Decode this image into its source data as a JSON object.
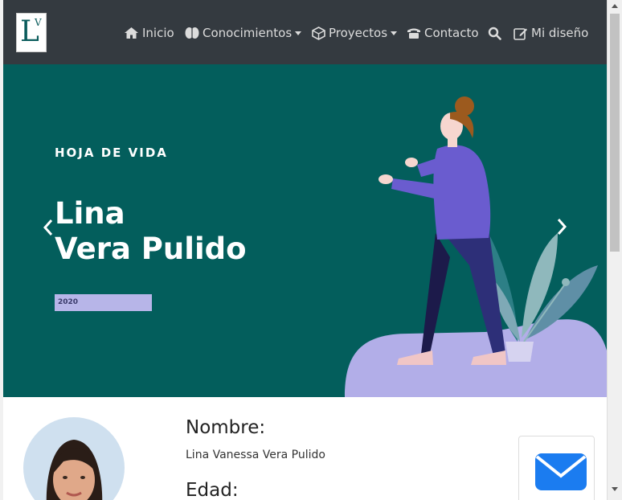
{
  "nav": {
    "items": [
      {
        "label": "Inicio",
        "icon": "home-icon"
      },
      {
        "label": "Conocimientos",
        "icon": "brain-icon",
        "dropdown": true
      },
      {
        "label": "Proyectos",
        "icon": "cube-icon",
        "dropdown": true
      },
      {
        "label": "Contacto",
        "icon": "phone-icon"
      },
      {
        "label": "Mi diseño",
        "icon": "edit-icon"
      }
    ],
    "search_icon": "search-icon"
  },
  "hero": {
    "subtitle": "HOJA DE VIDA",
    "name_line1": "Lina",
    "name_line2": "Vera Pulido",
    "badge": "2020"
  },
  "profile": {
    "name_label": "Nombre:",
    "name_value": "Lina Vanessa Vera Pulido",
    "age_label": "Edad:"
  },
  "colors": {
    "navbar": "#343a40",
    "hero_bg": "#035e5c",
    "accent_purple": "#6a5ccf",
    "mail_blue": "#1b7cf0"
  }
}
